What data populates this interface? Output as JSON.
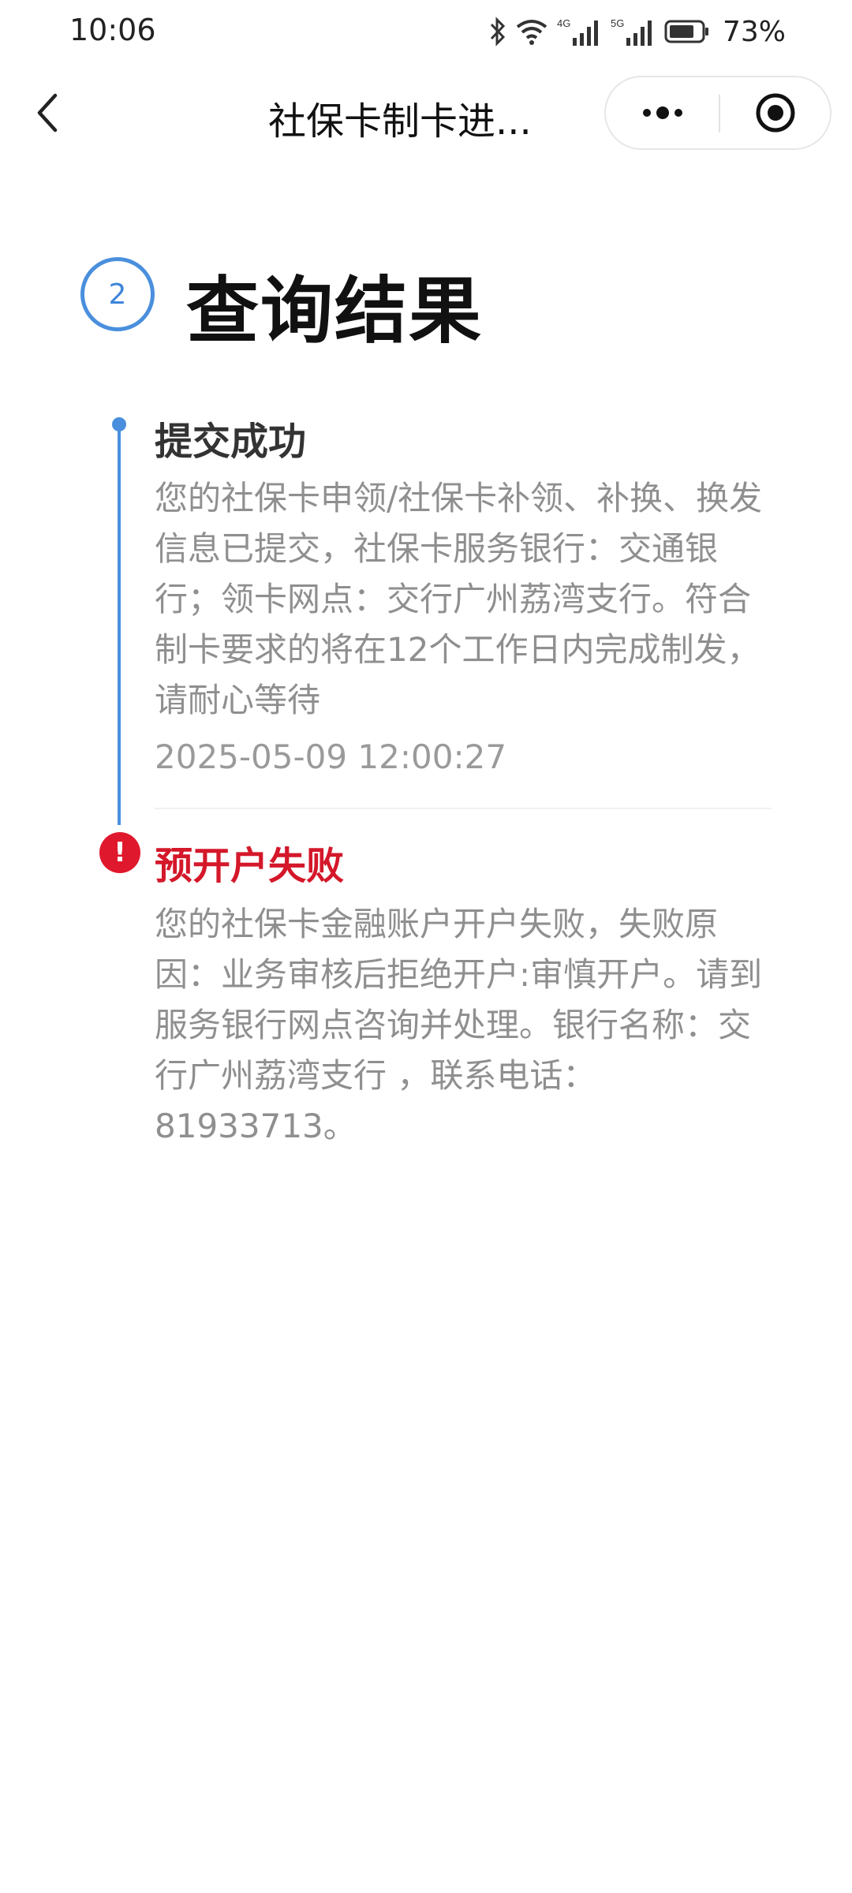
{
  "status_bar": {
    "time": "10:06",
    "signal_1_label": "4G",
    "signal_2_label": "5G",
    "battery_percent": "73%"
  },
  "nav": {
    "title": "社保卡制卡进...",
    "more_icon": "more-dots-icon",
    "close_icon": "target-close-icon"
  },
  "step": {
    "number": "2",
    "title": "查询结果"
  },
  "timeline": [
    {
      "title": "提交成功",
      "description": "您的社保卡申领/社保卡补领、补换、换发信息已提交，社保卡服务银行：交通银行；领卡网点：交行广州荔湾支行。符合制卡要求的将在12个工作日内完成制发，请耐心等待",
      "time": "2025-05-09 12:00:27",
      "status": "success"
    },
    {
      "title": "预开户失败",
      "description": "您的社保卡金融账户开户失败，失败原因：业务审核后拒绝开户:审慎开户。请到服务银行网点咨询并处理。银行名称：交行广州荔湾支行 ，联系电话： 81933713。",
      "status": "error"
    }
  ],
  "colors": {
    "accent": "#4a8fdd",
    "error": "#e0182d",
    "error_text": "#d4182a",
    "muted_text": "#8f8f8f"
  }
}
